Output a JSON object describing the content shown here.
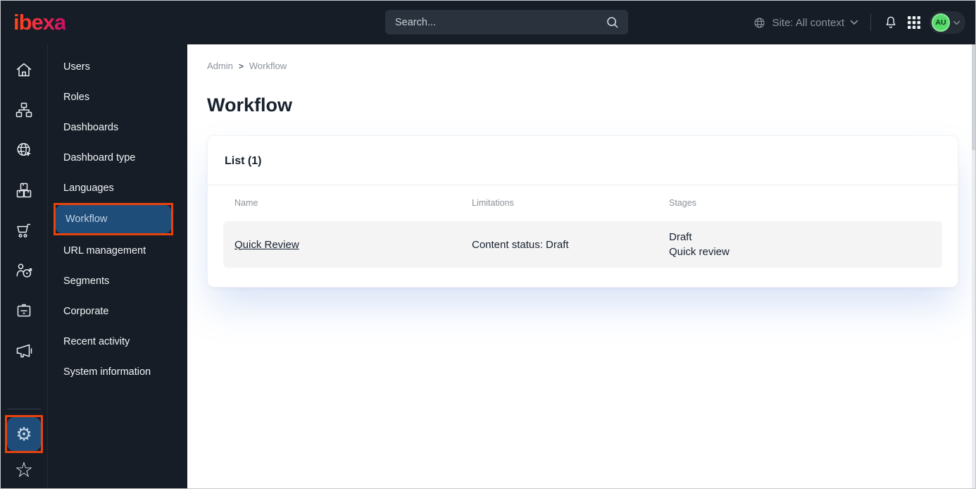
{
  "topbar": {
    "logo": "ibexa",
    "search_placeholder": "Search...",
    "site_context": "Site: All context",
    "avatar_initials": "AU"
  },
  "sidebar": {
    "rail_icons": [
      "home-icon",
      "content-tree-icon",
      "site-globe-icon",
      "product-boxes-icon",
      "commerce-cart-icon",
      "customer-target-icon",
      "corporate-badge-icon",
      "marketing-megaphone-icon",
      "settings-gear-icon",
      "bookmarks-star-icon"
    ],
    "gear_glyph": "⚙",
    "star_glyph": "☆",
    "active_icon": "settings-gear-icon"
  },
  "menu": {
    "items": [
      "Users",
      "Roles",
      "Dashboards",
      "Dashboard type",
      "Languages",
      "Workflow",
      "URL management",
      "Segments",
      "Corporate",
      "Recent activity",
      "System information"
    ],
    "active_item": "Workflow"
  },
  "breadcrumb": {
    "items": [
      "Admin",
      "Workflow"
    ],
    "separator": ">"
  },
  "page": {
    "title": "Workflow"
  },
  "card": {
    "heading": "List (1)",
    "table": {
      "columns": [
        "Name",
        "Limitations",
        "Stages"
      ],
      "rows": [
        {
          "name": "Quick Review",
          "limitations": "Content status: Draft",
          "stages": [
            "Draft",
            "Quick review"
          ]
        }
      ]
    }
  },
  "colors": {
    "topbar_bg": "#161d27",
    "active_blue": "#1f4d7a",
    "annotation_red": "#e8420d",
    "avatar_green": "#57d96a",
    "logo_gradient": [
      "#ff4713",
      "#cb0f69"
    ],
    "row_bg": "#f4f4f5"
  }
}
